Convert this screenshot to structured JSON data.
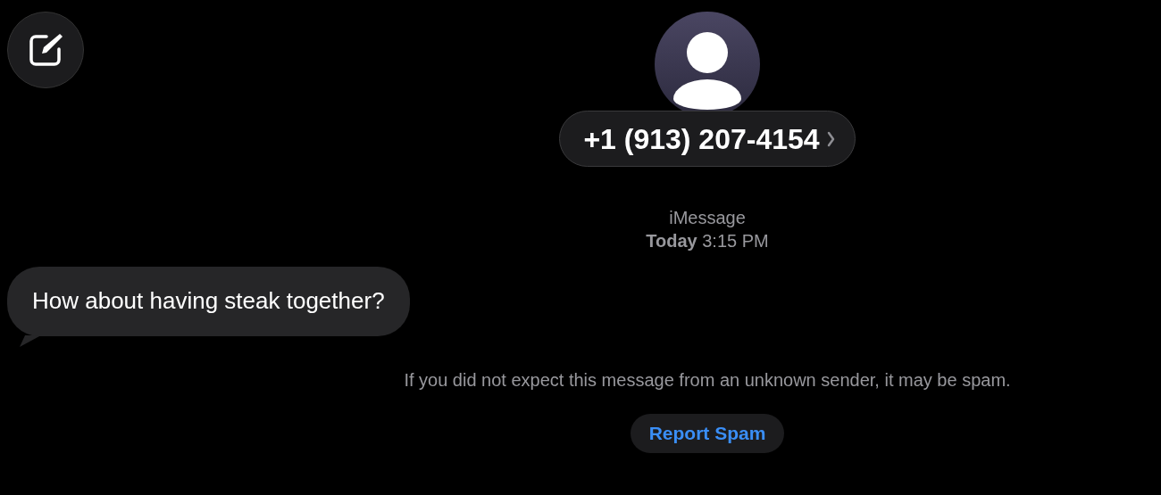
{
  "contact": {
    "phone": "+1 (913) 207-4154"
  },
  "service": "iMessage",
  "timestamp": "**Today** 3:15 PM",
  "messages": [
    {
      "kind": "incoming",
      "text": "How about having steak together?"
    }
  ],
  "spam_notice": {
    "text": "If you did not expect this message from an unknown sender, it may be spam.",
    "button": "Report Spam"
  }
}
